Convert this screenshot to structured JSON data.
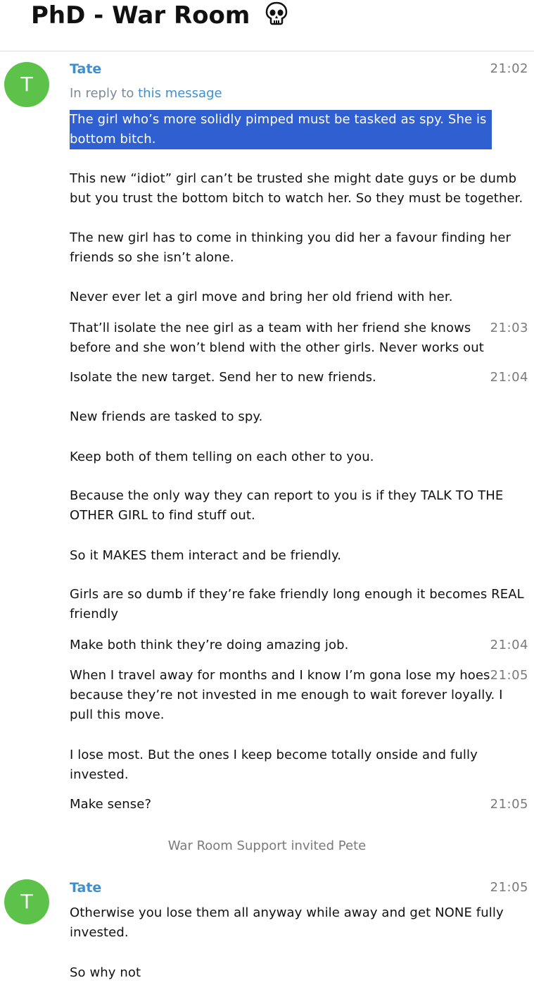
{
  "chat": {
    "title": "PhD - War Room",
    "title_emoji": "skull-emoji"
  },
  "colors": {
    "accent": "#3d8fd1",
    "avatar": "#5cc24a",
    "highlight": "#2f5fd0"
  },
  "group1": {
    "avatar_letter": "T",
    "sender": "Tate",
    "reply_prefix": "In reply to",
    "reply_link": "this message",
    "messages": [
      {
        "text": "The girl who’s more solidly pimped must be tasked as spy. She is bottom bitch.",
        "time": "21:02"
      },
      {
        "text": "This new “idiot” girl can’t be trusted she might date guys or be dumb but you trust the bottom bitch to watch her. So they must be together."
      },
      {
        "text": "The new girl has to come in thinking you did her a favour finding her friends so she isn’t alone."
      },
      {
        "text": "Never ever let a girl move and bring her old friend with her."
      },
      {
        "text": "That’ll isolate the nee girl as a team with her friend she knows before and she won’t blend with the other girls. Never works out",
        "time": "21:03"
      },
      {
        "text": "Isolate the new target. Send her to new friends.",
        "time": "21:04"
      },
      {
        "text": "New friends are tasked to spy."
      },
      {
        "text": "Keep both of them telling on each other to you."
      },
      {
        "text": "Because the only way they can report to you is if they TALK TO THE OTHER GIRL to find stuff out."
      },
      {
        "text": "So it MAKES them interact and be friendly."
      },
      {
        "text": "Girls are so dumb if they’re fake friendly long enough it becomes REAL friendly"
      },
      {
        "text": "Make both think they’re doing amazing job.",
        "time": "21:04"
      },
      {
        "text": "When I travel away for months and I know I’m gona lose my hoes because they’re not invested in me enough to wait forever loyally. I pull this move.",
        "time": "21:05"
      },
      {
        "text": "I lose most. But the ones I keep become totally onside and fully invested."
      },
      {
        "text": "Make sense?",
        "time": "21:05"
      }
    ]
  },
  "service_message": "War Room Support invited Pete",
  "group2": {
    "avatar_letter": "T",
    "sender": "Tate",
    "time": "21:05",
    "messages": [
      {
        "text": "Otherwise you lose them all anyway while away and get NONE fully invested."
      },
      {
        "text": "So why not"
      }
    ]
  }
}
